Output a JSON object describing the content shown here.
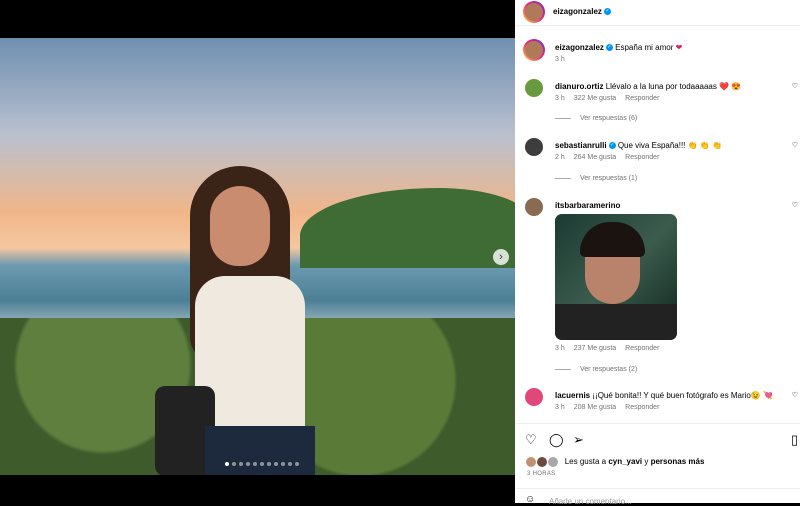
{
  "post": {
    "author": "eizagonzalez",
    "caption": "España mi amor",
    "caption_emoji": "❤",
    "time": "3 h"
  },
  "comments": [
    {
      "user": "dianuro.ortiz",
      "text": "Llévalo a la luna por todaaaaas ❤️ 😍",
      "time": "3 h",
      "likes": "322 Me gusta",
      "reply": "Responder",
      "view_replies": "Ver respuestas (6)"
    },
    {
      "user": "sebastianrulli",
      "verified": true,
      "text": "Que viva España!!! 👏 👏 👏",
      "time": "2 h",
      "likes": "264 Me gusta",
      "reply": "Responder",
      "view_replies": "Ver respuestas (1)"
    },
    {
      "user": "itsbarbaramerino",
      "text": "",
      "time": "3 h",
      "likes": "237 Me gusta",
      "reply": "Responder",
      "view_replies": "Ver respuestas (2)"
    },
    {
      "user": "lacuernis",
      "text": "¡¡Qué bonita!! Y qué buen fotógrafo es Mario😉 💘",
      "time": "3 h",
      "likes": "208 Me gusta",
      "reply": "Responder"
    }
  ],
  "likes_line": {
    "prefix": "Les gusta a",
    "user": "cyn_yavi",
    "middle": "y",
    "others": "personas más"
  },
  "time_ago": "3 HORAS",
  "add_comment_placeholder": "Añade un comentario...",
  "icons": [
    "heart-icon",
    "comment-icon",
    "share-icon",
    "bookmark-icon",
    "next-arrow-icon",
    "more-icon"
  ],
  "colors": {
    "accent": "#0095f6",
    "like": "#ed4956"
  }
}
